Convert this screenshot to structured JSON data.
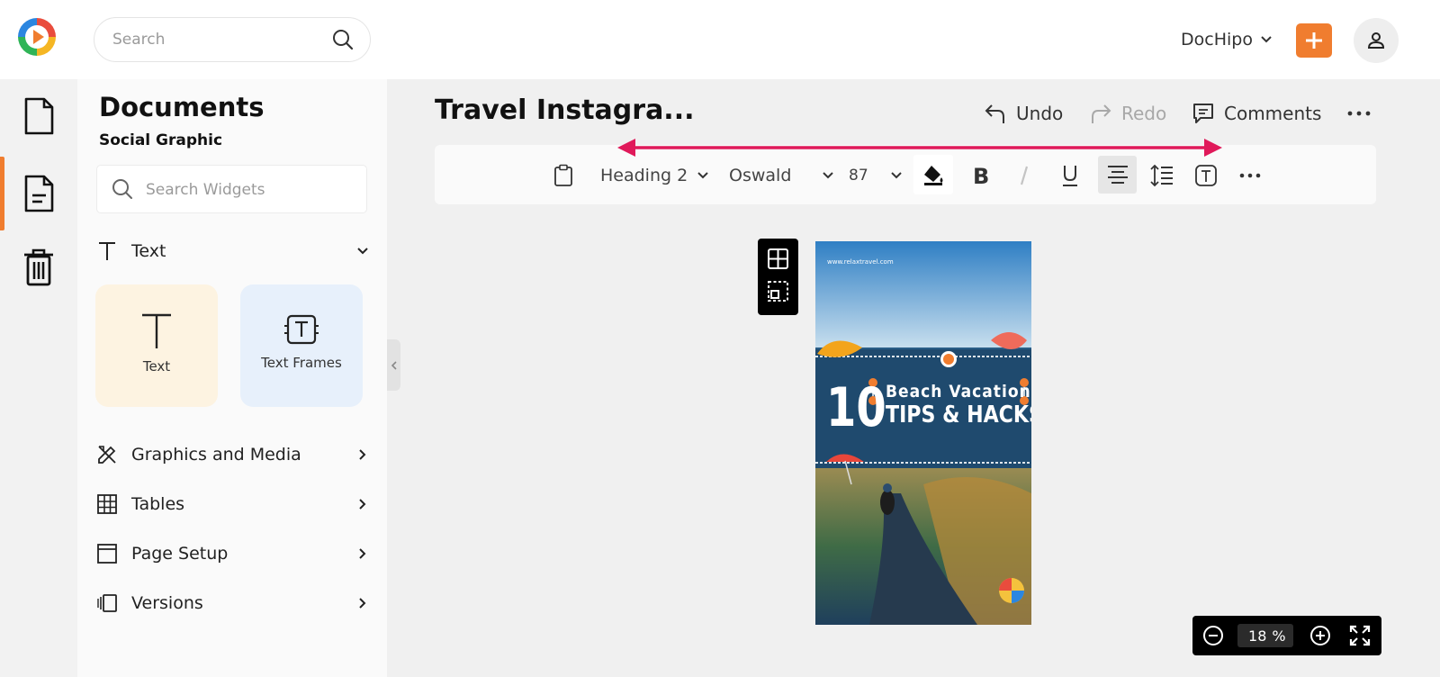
{
  "header": {
    "search_placeholder": "Search",
    "workspace": "DocHipo"
  },
  "panel": {
    "title": "Documents",
    "subtitle": "Social Graphic",
    "search_placeholder": "Search Widgets",
    "sections": [
      {
        "label": "Text",
        "icon": "text-icon"
      },
      {
        "label": "Graphics and Media",
        "icon": "pen-ruler-icon"
      },
      {
        "label": "Tables",
        "icon": "table-icon"
      },
      {
        "label": "Page Setup",
        "icon": "page-setup-icon"
      },
      {
        "label": "Versions",
        "icon": "versions-icon"
      }
    ],
    "cards": [
      {
        "label": "Text",
        "color": "#fdf3e1"
      },
      {
        "label": "Text Frames",
        "color": "#e7f0fb"
      }
    ]
  },
  "editor": {
    "doc_title": "Travel Instagra...",
    "undo": "Undo",
    "redo": "Redo",
    "comments": "Comments",
    "toolbar": {
      "text_style": "Heading 2",
      "font": "Oswald",
      "font_size": "87"
    },
    "canvas": {
      "url": "www.relaxtravel.com",
      "number": "10",
      "line1": "Beach Vacation",
      "line2": "TIPS & HACKS"
    },
    "zoom": {
      "value": "18",
      "unit": "%"
    }
  },
  "colors": {
    "accent": "#f07d2f",
    "annotation_arrow": "#e0195a"
  }
}
